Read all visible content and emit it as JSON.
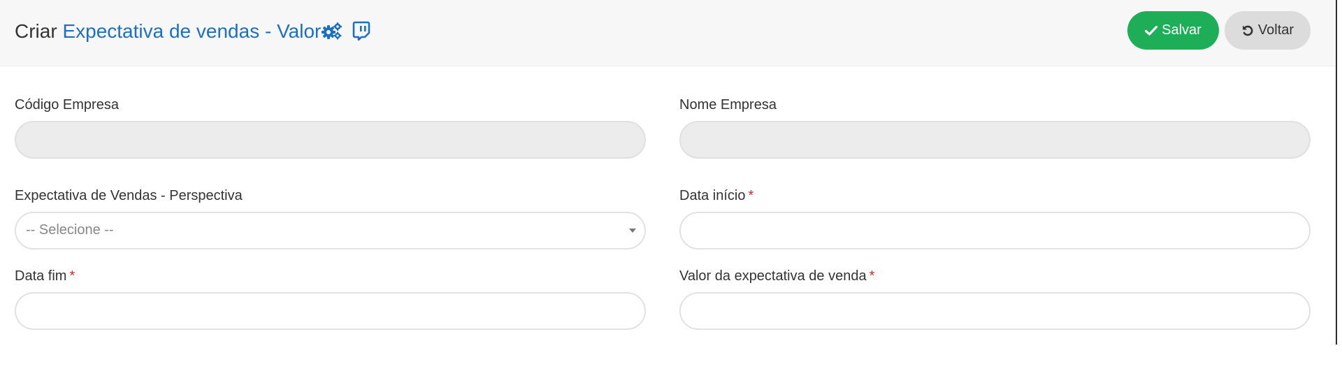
{
  "header": {
    "title_prefix": "Criar",
    "title_main": "Expectativa de vendas - Valor",
    "icons": [
      "gears-icon",
      "chat-icon"
    ],
    "accent_color": "#1f6fc1"
  },
  "actions": {
    "save_label": "Salvar",
    "save_color": "#1fae58",
    "back_label": "Voltar"
  },
  "form": {
    "codigo_empresa": {
      "label": "Código Empresa",
      "value": ""
    },
    "nome_empresa": {
      "label": "Nome Empresa",
      "value": ""
    },
    "perspectiva": {
      "label": "Expectativa de Vendas - Perspectiva",
      "selected": "-- Selecione --"
    },
    "data_inicio": {
      "label": "Data início",
      "required": "*",
      "value": ""
    },
    "data_fim": {
      "label": "Data fim",
      "required": "*",
      "value": ""
    },
    "valor": {
      "label": "Valor da expectativa de venda",
      "required": "*",
      "value": ""
    }
  }
}
